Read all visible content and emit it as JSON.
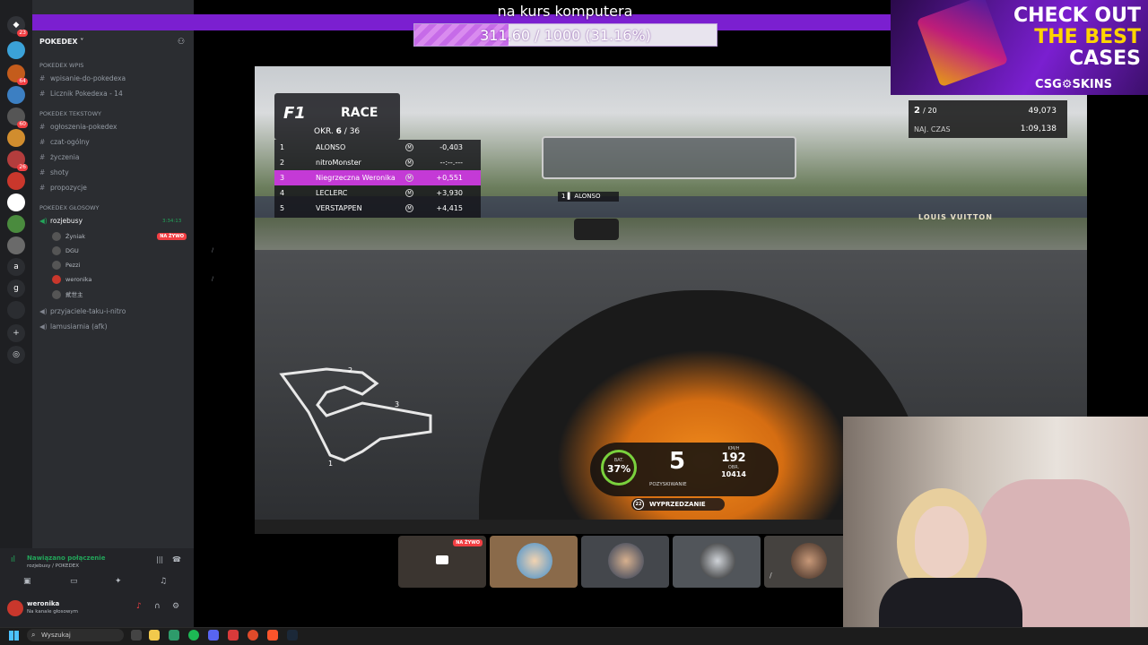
{
  "stream": {
    "title": "na kurs komputera",
    "progress_text": "311.60 / 1000 (31.16%)",
    "progress_fraction": 0.3116
  },
  "sidebar": {
    "server_name": "POKEDEX",
    "categories": [
      {
        "label": "POKEDEX Wpis",
        "channels": [
          "wpisanie-do-pokedexa",
          "Licznik Pokedexa - 14"
        ]
      },
      {
        "label": "POKEDEX Tekstowy",
        "channels": [
          "ogłoszenia-pokedex",
          "czat-ogólny",
          "życzenia",
          "shoty",
          "propozycje"
        ]
      },
      {
        "label": "POKEDEX GŁOSOWY",
        "channels": [
          "rozjebusy"
        ]
      }
    ],
    "voice_time": "3:34:13",
    "voice_users": [
      {
        "name": "Żyniak",
        "live": "NA ŻYWO"
      },
      {
        "name": "DGU",
        "live": ""
      },
      {
        "name": "Pezzi",
        "live": ""
      },
      {
        "name": "weronika",
        "live": ""
      },
      {
        "name": "貮世主",
        "live": ""
      }
    ],
    "extra_channels": [
      "przyjaciele-taku-i-nitro",
      "lamusiarnia (afk)"
    ]
  },
  "voice_panel": {
    "status": "Nawiązano połączenie",
    "location": "rozjebusy / POKEDEX",
    "user": "weronika",
    "user_status": "Na kanale głosowym"
  },
  "game": {
    "race_label": "RACE",
    "lap_label": "OKR.",
    "lap_current": "6",
    "lap_total": "36",
    "standings": [
      {
        "pos": "1",
        "name": "ALONSO",
        "tyre": "M",
        "gap": "-0,403"
      },
      {
        "pos": "2",
        "name": "nitroMonster",
        "tyre": "M",
        "gap": "--:--.---"
      },
      {
        "pos": "3",
        "name": "Niegrzeczna Weronika",
        "tyre": "M",
        "gap": "+0,551"
      },
      {
        "pos": "4",
        "name": "LECLERC",
        "tyre": "M",
        "gap": "+3,930"
      },
      {
        "pos": "5",
        "name": "VERSTAPPEN",
        "tyre": "M",
        "gap": "+4,415"
      }
    ],
    "ahead_label": "ALONSO",
    "ahead_pos": "1",
    "lap_pos": "2",
    "lap_pos_total": "/ 20",
    "lap_time": "49,073",
    "best_label": "NAJ. CZAS",
    "best_time": "1:09,138",
    "battery": "37%",
    "battery_label": "BAT.",
    "gear": "5",
    "speed": "192",
    "speed_unit": "KM/H",
    "rpm": "10414",
    "rpm_label": "OBR.",
    "mode_label": "POZYSKIWANIE",
    "overtake_label": "WYPRZEDZANIE",
    "overtake_count": "22",
    "track_sector_labels": [
      "1",
      "2",
      "3"
    ]
  },
  "ad": {
    "line1": "CHECK OUT",
    "line2": "THE BEST",
    "line3": "CASES",
    "brand": "CSG⚙SKINS"
  },
  "participants": {
    "live_badge": "NA ŻYWO"
  },
  "taskbar": {
    "search_placeholder": "Wyszukaj"
  },
  "colors": {
    "accent_purple": "#7b1fd0",
    "discord_green": "#23a55a",
    "live_red": "#f23f43",
    "highlight_row": "#c43ad6"
  }
}
